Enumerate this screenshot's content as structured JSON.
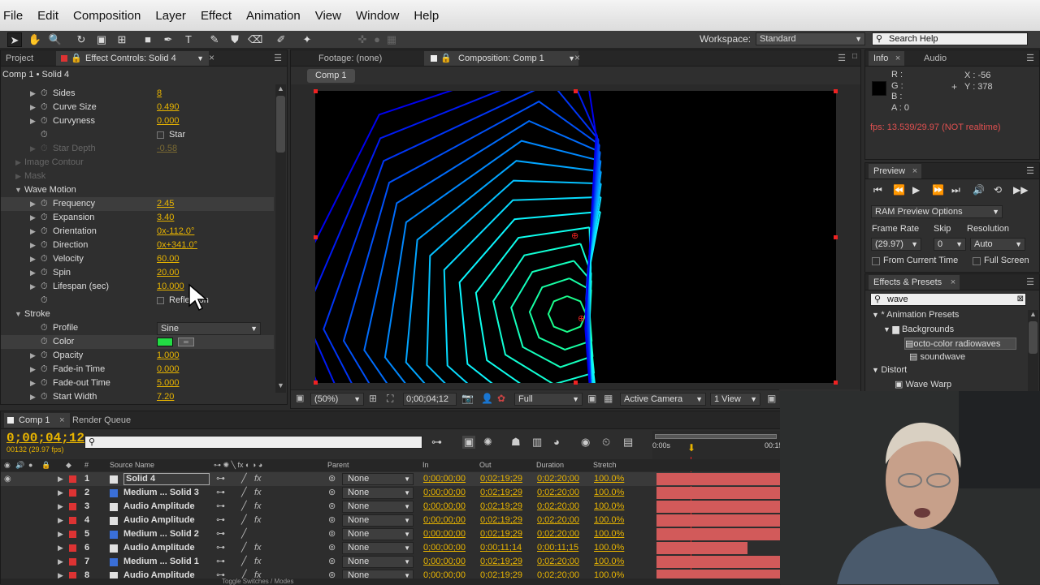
{
  "menu": [
    "File",
    "Edit",
    "Composition",
    "Layer",
    "Effect",
    "Animation",
    "View",
    "Window",
    "Help"
  ],
  "toolbar": {
    "workspace_label": "Workspace:",
    "workspace_value": "Standard",
    "search_placeholder": "Search Help"
  },
  "left_panel": {
    "tab_project": "Project",
    "tab_effect": "Effect Controls: Solid 4",
    "subtitle": "Comp 1 • Solid 4",
    "rows": [
      {
        "label": "Sides",
        "value": "8"
      },
      {
        "label": "Curve Size",
        "value": "0.490"
      },
      {
        "label": "Curvyness",
        "value": "0.000"
      },
      {
        "label": "",
        "value": "Star"
      },
      {
        "label": "Star Depth",
        "value": "-0.58"
      },
      {
        "label": "Image Contour",
        "value": ""
      },
      {
        "label": "Mask",
        "value": ""
      },
      {
        "label": "Wave Motion",
        "value": ""
      },
      {
        "label": "Frequency",
        "value": "2.45"
      },
      {
        "label": "Expansion",
        "value": "3.40"
      },
      {
        "label": "Orientation",
        "value": "0x-112.0°"
      },
      {
        "label": "Direction",
        "value": "0x+341.0°"
      },
      {
        "label": "Velocity",
        "value": "60.00"
      },
      {
        "label": "Spin",
        "value": "20.00"
      },
      {
        "label": "Lifespan (sec)",
        "value": "10.000"
      },
      {
        "label": "",
        "value": "Reflection"
      },
      {
        "label": "Stroke",
        "value": ""
      },
      {
        "label": "Profile",
        "value": "Sine"
      },
      {
        "label": "Color",
        "value": "#22dd44"
      },
      {
        "label": "Opacity",
        "value": "1.000"
      },
      {
        "label": "Fade-in Time",
        "value": "0.000"
      },
      {
        "label": "Fade-out Time",
        "value": "5.000"
      },
      {
        "label": "Start Width",
        "value": "7.20"
      }
    ]
  },
  "center": {
    "tab_footage": "Footage: (none)",
    "tab_comp": "Composition: Comp 1",
    "comp_chip": "Comp 1",
    "zoom": "(50%)",
    "timecode": "0;00;04;12",
    "resolution": "Full",
    "camera": "Active Camera",
    "views": "1 View"
  },
  "info": {
    "tab_info": "Info",
    "tab_audio": "Audio",
    "r": "R :",
    "g": "G :",
    "b": "B :",
    "a": "A : 0",
    "x": "X : -56",
    "y": "Y : 378",
    "fps": "fps: 13.539/29.97 (NOT realtime)"
  },
  "preview": {
    "tab": "Preview",
    "ram": "RAM Preview Options",
    "frame_rate_label": "Frame Rate",
    "skip_label": "Skip",
    "resolution_label": "Resolution",
    "frame_rate": "(29.97)",
    "skip": "0",
    "resolution": "Auto",
    "from_current": "From Current Time",
    "full_screen": "Full Screen"
  },
  "effects": {
    "tab": "Effects & Presets",
    "search": "wave",
    "items": [
      "* Animation Presets",
      "Backgrounds",
      "octo-color radiowaves",
      "soundwave",
      "Distort",
      "Wave Warp"
    ]
  },
  "timeline": {
    "tab_comp": "Comp 1",
    "tab_render": "Render Queue",
    "timecode": "0;00;04;12",
    "frames": "00132 (29.97 fps)",
    "headers": {
      "num": "#",
      "source": "Source Name",
      "parent": "Parent",
      "in": "In",
      "out": "Out",
      "duration": "Duration",
      "stretch": "Stretch"
    },
    "ruler_start": "0:00s",
    "ruler_end": "00:15",
    "layers": [
      {
        "n": "1",
        "name": "Solid 4",
        "color": "#e0e0e0",
        "parent": "None",
        "in": "0;00;00;00",
        "out": "0;02;19;29",
        "dur": "0;02;20;00",
        "stretch": "100.0%"
      },
      {
        "n": "2",
        "name": "Medium ... Solid 3",
        "color": "#3a6fd8",
        "parent": "None",
        "in": "0;00;00;00",
        "out": "0;02;19;29",
        "dur": "0;02;20;00",
        "stretch": "100.0%"
      },
      {
        "n": "3",
        "name": "Audio Amplitude",
        "color": "#e0e0e0",
        "parent": "None",
        "in": "0;00;00;00",
        "out": "0;02;19;29",
        "dur": "0;02;20;00",
        "stretch": "100.0%"
      },
      {
        "n": "4",
        "name": "Audio Amplitude",
        "color": "#e0e0e0",
        "parent": "None",
        "in": "0;00;00;00",
        "out": "0;02;19;29",
        "dur": "0;02;20;00",
        "stretch": "100.0%"
      },
      {
        "n": "5",
        "name": "Medium ... Solid 2",
        "color": "#3a6fd8",
        "parent": "None",
        "in": "0;00;00;00",
        "out": "0;02;19;29",
        "dur": "0;02;20;00",
        "stretch": "100.0%"
      },
      {
        "n": "6",
        "name": "Audio Amplitude",
        "color": "#e0e0e0",
        "parent": "None",
        "in": "0;00;00;00",
        "out": "0;00;11;14",
        "dur": "0;00;11;15",
        "stretch": "100.0%"
      },
      {
        "n": "7",
        "name": "Medium ... Solid 1",
        "color": "#3a6fd8",
        "parent": "None",
        "in": "0;00;00;00",
        "out": "0;02;19;29",
        "dur": "0;02;20;00",
        "stretch": "100.0%"
      },
      {
        "n": "8",
        "name": "Audio Amplitude",
        "color": "#e0e0e0",
        "parent": "None",
        "in": "0;00;00;00",
        "out": "0;02;19;29",
        "dur": "0;02;20;00",
        "stretch": "100.0%"
      }
    ],
    "footer": "Toggle Switches / Modes"
  }
}
